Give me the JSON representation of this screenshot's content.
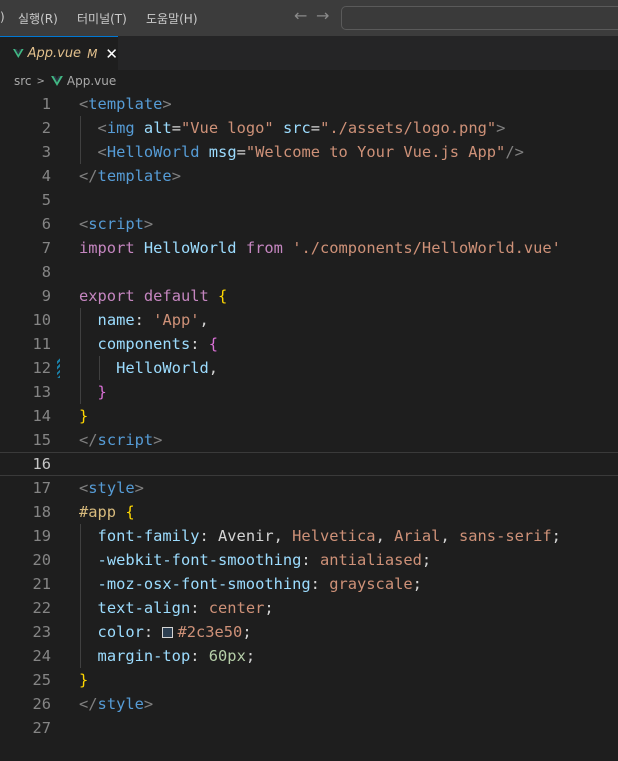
{
  "titlebar": {
    "menu_left_fragment": ")",
    "menu_run": "실행(R)",
    "menu_terminal": "터미널(T)",
    "menu_help": "도움말(H)",
    "nav_back": "←",
    "nav_forward": "→"
  },
  "tab": {
    "label": "App.vue",
    "modified": "M",
    "close": "✕"
  },
  "breadcrumb": {
    "folder": "src",
    "separator": ">",
    "file": "App.vue"
  },
  "editor": {
    "current_line": 16,
    "colors": {
      "accent": "#0078d4",
      "modified_file": "#e2c08d",
      "vue_green": "#41b883"
    },
    "lines": [
      [
        [
          "tk-bracket",
          "<"
        ],
        [
          "tk-tag",
          "template"
        ],
        [
          "tk-bracket",
          ">"
        ]
      ],
      [
        [
          "tk-plain",
          "  "
        ],
        [
          "tk-bracket",
          "<"
        ],
        [
          "tk-tag",
          "img"
        ],
        [
          "tk-plain",
          " "
        ],
        [
          "tk-attr",
          "alt"
        ],
        [
          "tk-plain",
          "="
        ],
        [
          "tk-str",
          "\"Vue logo\""
        ],
        [
          "tk-plain",
          " "
        ],
        [
          "tk-attr",
          "src"
        ],
        [
          "tk-plain",
          "="
        ],
        [
          "tk-str",
          "\"./assets/logo.png\""
        ],
        [
          "tk-bracket",
          ">"
        ]
      ],
      [
        [
          "tk-plain",
          "  "
        ],
        [
          "tk-bracket",
          "<"
        ],
        [
          "tk-tag",
          "HelloWorld"
        ],
        [
          "tk-plain",
          " "
        ],
        [
          "tk-attr",
          "msg"
        ],
        [
          "tk-plain",
          "="
        ],
        [
          "tk-str",
          "\"Welcome to Your Vue.js App\""
        ],
        [
          "tk-bracket",
          "/>"
        ]
      ],
      [
        [
          "tk-bracket",
          "</"
        ],
        [
          "tk-tag",
          "template"
        ],
        [
          "tk-bracket",
          ">"
        ]
      ],
      [],
      [
        [
          "tk-bracket",
          "<"
        ],
        [
          "tk-tag",
          "script"
        ],
        [
          "tk-bracket",
          ">"
        ]
      ],
      [
        [
          "tk-kw",
          "import"
        ],
        [
          "tk-plain",
          " "
        ],
        [
          "tk-var",
          "HelloWorld"
        ],
        [
          "tk-plain",
          " "
        ],
        [
          "tk-kw",
          "from"
        ],
        [
          "tk-plain",
          " "
        ],
        [
          "tk-str",
          "'./components/HelloWorld.vue'"
        ]
      ],
      [],
      [
        [
          "tk-kw",
          "export"
        ],
        [
          "tk-plain",
          " "
        ],
        [
          "tk-kw",
          "default"
        ],
        [
          "tk-plain",
          " "
        ],
        [
          "tk-brace1",
          "{"
        ]
      ],
      [
        [
          "tk-plain",
          "  "
        ],
        [
          "tk-var",
          "name"
        ],
        [
          "tk-plain",
          ": "
        ],
        [
          "tk-str",
          "'App'"
        ],
        [
          "tk-plain",
          ","
        ]
      ],
      [
        [
          "tk-plain",
          "  "
        ],
        [
          "tk-var",
          "components"
        ],
        [
          "tk-plain",
          ": "
        ],
        [
          "tk-brace2",
          "{"
        ]
      ],
      [
        [
          "tk-plain",
          "    "
        ],
        [
          "tk-var",
          "HelloWorld"
        ],
        [
          "tk-plain",
          ","
        ]
      ],
      [
        [
          "tk-plain",
          "  "
        ],
        [
          "tk-brace2",
          "}"
        ]
      ],
      [
        [
          "tk-brace1",
          "}"
        ]
      ],
      [
        [
          "tk-bracket",
          "</"
        ],
        [
          "tk-tag",
          "script"
        ],
        [
          "tk-bracket",
          ">"
        ]
      ],
      [],
      [
        [
          "tk-bracket",
          "<"
        ],
        [
          "tk-tag",
          "style"
        ],
        [
          "tk-bracket",
          ">"
        ]
      ],
      [
        [
          "tk-sel",
          "#app"
        ],
        [
          "tk-plain",
          " "
        ],
        [
          "tk-brace1",
          "{"
        ]
      ],
      [
        [
          "tk-plain",
          "  "
        ],
        [
          "tk-prop",
          "font-family"
        ],
        [
          "tk-plain",
          ": Avenir, "
        ],
        [
          "tk-str",
          "Helvetica"
        ],
        [
          "tk-plain",
          ", "
        ],
        [
          "tk-str",
          "Arial"
        ],
        [
          "tk-plain",
          ", "
        ],
        [
          "tk-str",
          "sans-serif"
        ],
        [
          "tk-plain",
          ";"
        ]
      ],
      [
        [
          "tk-plain",
          "  "
        ],
        [
          "tk-prop",
          "-webkit-font-smoothing"
        ],
        [
          "tk-plain",
          ": "
        ],
        [
          "tk-str",
          "antialiased"
        ],
        [
          "tk-plain",
          ";"
        ]
      ],
      [
        [
          "tk-plain",
          "  "
        ],
        [
          "tk-prop",
          "-moz-osx-font-smoothing"
        ],
        [
          "tk-plain",
          ": "
        ],
        [
          "tk-str",
          "grayscale"
        ],
        [
          "tk-plain",
          ";"
        ]
      ],
      [
        [
          "tk-plain",
          "  "
        ],
        [
          "tk-prop",
          "text-align"
        ],
        [
          "tk-plain",
          ": "
        ],
        [
          "tk-str",
          "center"
        ],
        [
          "tk-plain",
          ";"
        ]
      ],
      [
        [
          "tk-plain",
          "  "
        ],
        [
          "tk-prop",
          "color"
        ],
        [
          "tk-plain",
          ": "
        ],
        [
          "swatch",
          "#2c3e50"
        ],
        [
          "tk-str",
          "#2c3e50"
        ],
        [
          "tk-plain",
          ";"
        ]
      ],
      [
        [
          "tk-plain",
          "  "
        ],
        [
          "tk-prop",
          "margin-top"
        ],
        [
          "tk-plain",
          ": "
        ],
        [
          "tk-num",
          "60px"
        ],
        [
          "tk-plain",
          ";"
        ]
      ],
      [
        [
          "tk-brace1",
          "}"
        ]
      ],
      [
        [
          "tk-bracket",
          "</"
        ],
        [
          "tk-tag",
          "style"
        ],
        [
          "tk-bracket",
          ">"
        ]
      ],
      []
    ]
  }
}
